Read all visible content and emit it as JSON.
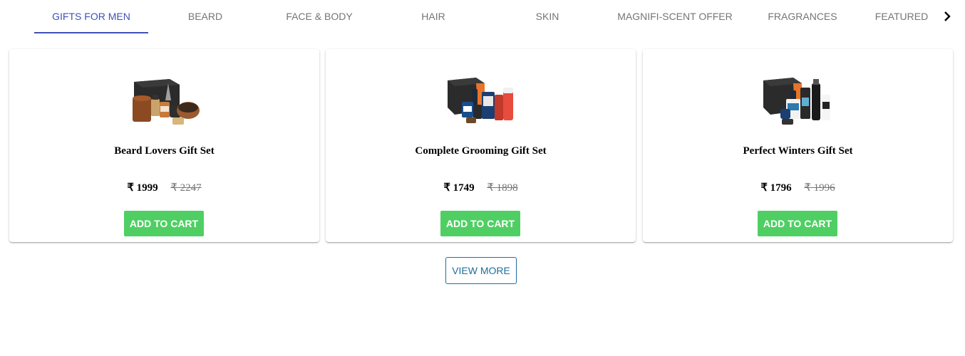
{
  "tabs": [
    {
      "label": "GIFTS FOR MEN",
      "active": true
    },
    {
      "label": "BEARD"
    },
    {
      "label": "FACE & BODY"
    },
    {
      "label": "HAIR"
    },
    {
      "label": "SKIN"
    },
    {
      "label": "MAGNIFI-SCENT OFFER"
    },
    {
      "label": "FRAGRANCES"
    },
    {
      "label": "FEATURED"
    }
  ],
  "products": [
    {
      "title": "Beard Lovers Gift Set",
      "price": "₹ 1999",
      "old_price": "₹ 2247",
      "button": "ADD TO CART"
    },
    {
      "title": "Complete Grooming Gift Set",
      "price": "₹ 1749",
      "old_price": "₹ 1898",
      "button": "ADD TO CART"
    },
    {
      "title": "Perfect Winters Gift Set",
      "price": "₹ 1796",
      "old_price": "₹ 1996",
      "button": "ADD TO CART"
    }
  ],
  "view_more_label": "VIEW MORE",
  "colors": {
    "tab_active": "#3f51b5",
    "add_to_cart": "#4fcf63",
    "view_more": "#1f6e9c"
  },
  "icons": {
    "tab_scroll": "chevron-right-icon"
  }
}
